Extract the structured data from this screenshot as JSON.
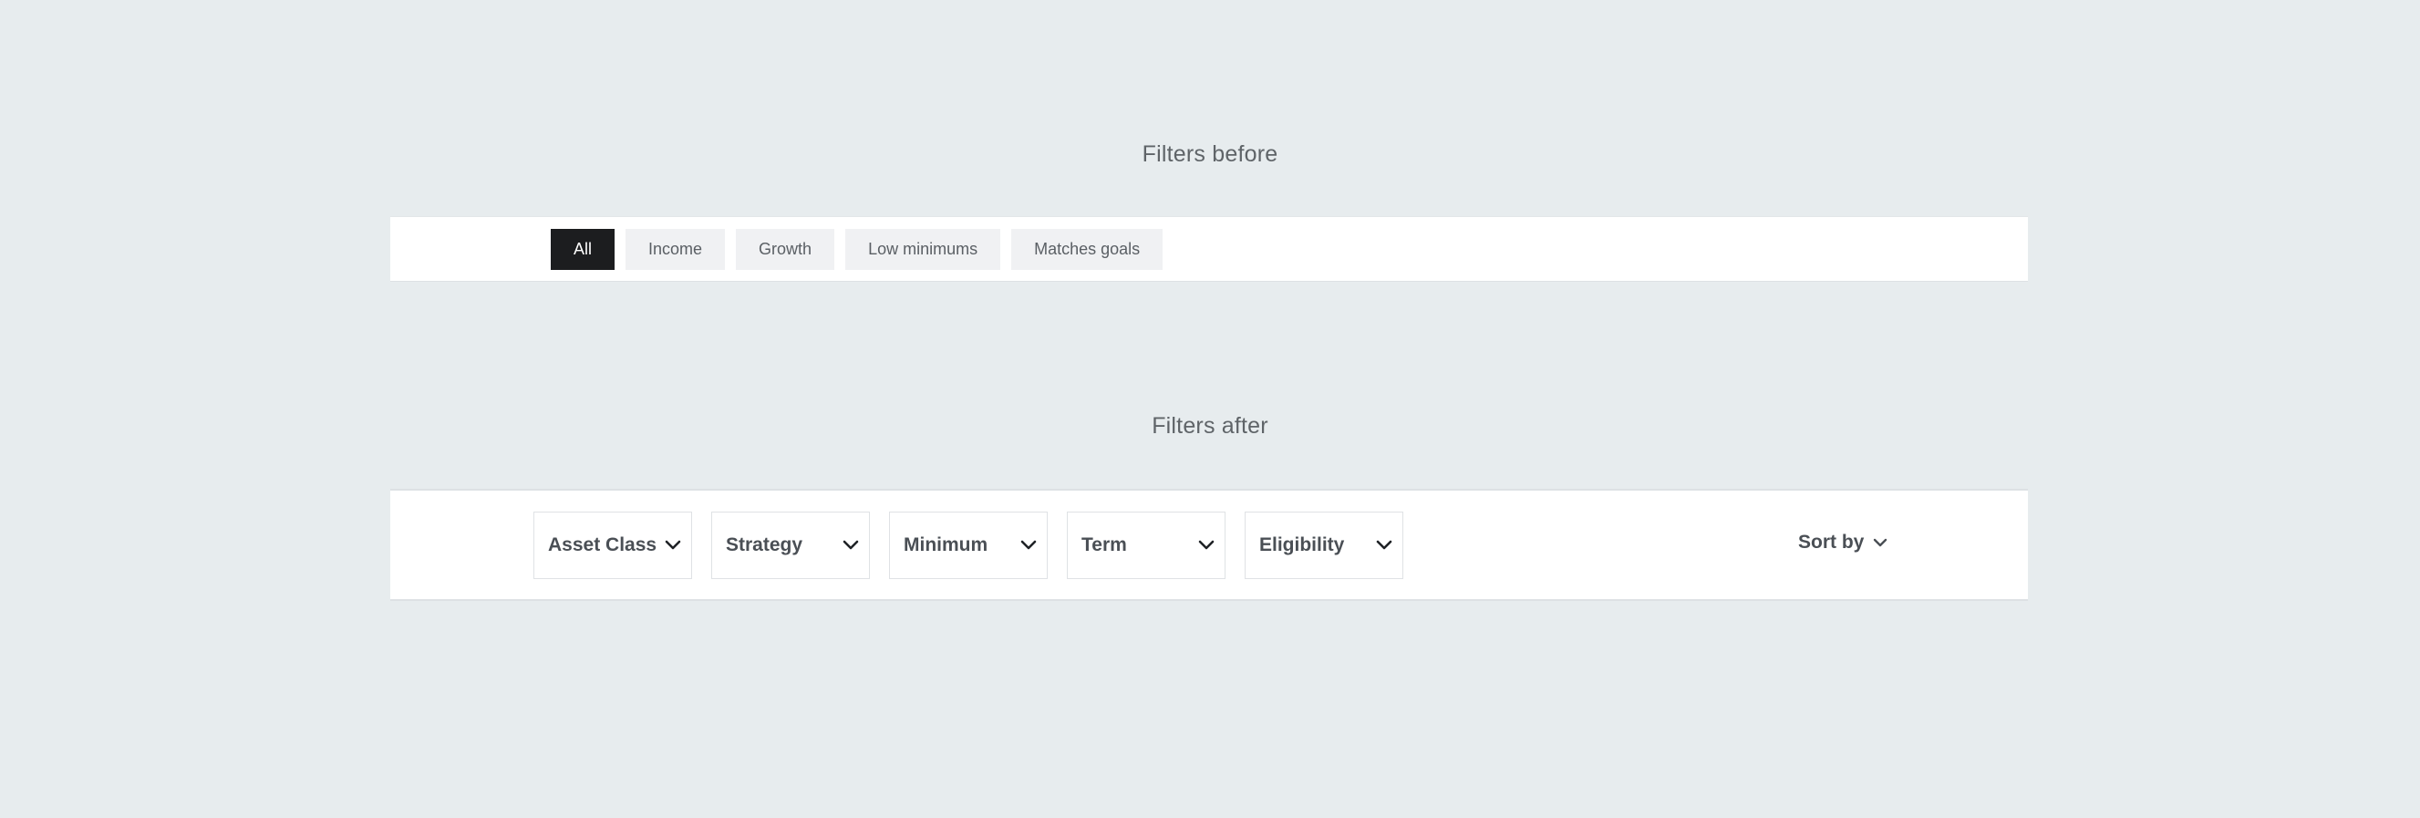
{
  "before": {
    "title": "Filters before",
    "chips": [
      {
        "label": "All",
        "active": true
      },
      {
        "label": "Income",
        "active": false
      },
      {
        "label": "Growth",
        "active": false
      },
      {
        "label": "Low minimums",
        "active": false
      },
      {
        "label": "Matches goals",
        "active": false
      }
    ]
  },
  "after": {
    "title": "Filters after",
    "dropdowns": [
      {
        "label": "Asset Class",
        "icon": "chevron-down-icon"
      },
      {
        "label": "Strategy",
        "icon": "chevron-down-icon"
      },
      {
        "label": "Minimum",
        "icon": "chevron-down-icon"
      },
      {
        "label": "Term",
        "icon": "chevron-down-icon"
      },
      {
        "label": "Eligibility",
        "icon": "chevron-down-icon"
      }
    ],
    "sort": {
      "label": "Sort by",
      "icon": "chevron-down-icon"
    }
  },
  "colors": {
    "background": "#e7ecee",
    "panel": "#ffffff",
    "chip_active": "#1c1d1f",
    "chip_inactive": "#f0f1f3",
    "text_muted": "#5f6468"
  }
}
